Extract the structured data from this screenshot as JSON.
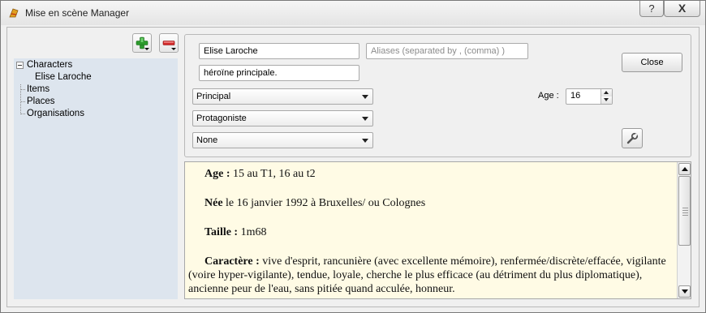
{
  "window": {
    "title": "Mise en scène Manager",
    "help_symbol": "?",
    "close_symbol": "X"
  },
  "toolbar": {
    "add_icon": "green-plus-icon",
    "remove_icon": "red-minus-icon"
  },
  "tree": {
    "items": [
      {
        "label": "Characters",
        "expanded": true
      },
      {
        "label": "Elise Laroche",
        "selected": true
      },
      {
        "label": "Items"
      },
      {
        "label": "Places"
      },
      {
        "label": "Organisations"
      }
    ]
  },
  "editor": {
    "name_value": "Elise Laroche",
    "aliases_placeholder": "Aliases (separated by , (comma) )",
    "description_value": "héroïne principale.",
    "importance_value": "Principal",
    "role_value": "Protagoniste",
    "third_value": "None",
    "close_label": "Close",
    "age_label": "Age :",
    "age_value": "16",
    "tool_icon": "wrench-icon"
  },
  "notes": {
    "lines": [
      {
        "label": "Age :",
        "text": " 15 au T1, 16 au t2"
      },
      {
        "label": "Née",
        "text": " le 16 janvier 1992 à Bruxelles/ ou Colognes"
      },
      {
        "label": "Taille :",
        "text": " 1m68"
      },
      {
        "label": "Caractère :",
        "text": " vive d'esprit, rancunière (avec excellente mémoire), renfermée/discrète/effacée, vigilante (voire hyper-vigilante), tendue, loyale, cherche le plus efficace (au détriment du plus diplomatique), ancienne peur de l'eau, sans pitiée quand acculée, honneur."
      }
    ]
  },
  "colors": {
    "notes_background": "#fffbe5",
    "tree_background": "#dde5ee"
  }
}
